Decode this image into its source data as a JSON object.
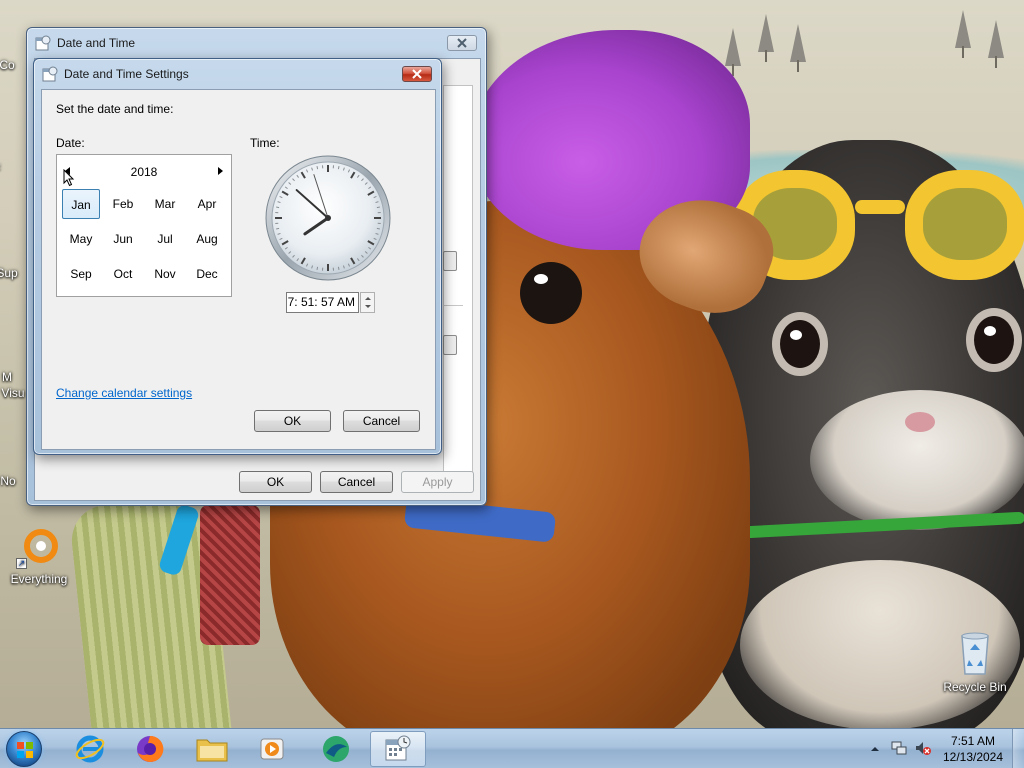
{
  "desktop": {
    "icons": [
      {
        "label": "Everything"
      },
      {
        "label": "Recycle Bin"
      }
    ],
    "partial_labels": [
      "Co",
      "F",
      "Sup",
      "M",
      "Visu",
      "No"
    ]
  },
  "outer_window": {
    "title": "Date and Time",
    "ok_label": "OK",
    "cancel_label": "Cancel",
    "apply_label": "Apply"
  },
  "inner_window": {
    "title": "Date and Time Settings",
    "instruction": "Set the date and time:",
    "date_label": "Date:",
    "time_label": "Time:",
    "calendar": {
      "year": "2018",
      "months": [
        "Jan",
        "Feb",
        "Mar",
        "Apr",
        "May",
        "Jun",
        "Jul",
        "Aug",
        "Sep",
        "Oct",
        "Nov",
        "Dec"
      ],
      "selected": "Jan"
    },
    "time_value": "7: 51: 57 AM",
    "clock": {
      "hour": 7,
      "minute": 51,
      "second": 57
    },
    "change_calendar_link": "Change calendar settings",
    "ok_label": "OK",
    "cancel_label": "Cancel"
  },
  "taskbar": {
    "apps": [
      "start-orb",
      "internet-explorer",
      "firefox",
      "file-explorer",
      "media-player",
      "app-green",
      "date-time-settings"
    ],
    "active_app": "date-time-settings",
    "clock_time": "7:51 AM",
    "clock_date": "12/13/2024",
    "tray": [
      "show-hidden-icons",
      "network",
      "volume-muted"
    ]
  }
}
